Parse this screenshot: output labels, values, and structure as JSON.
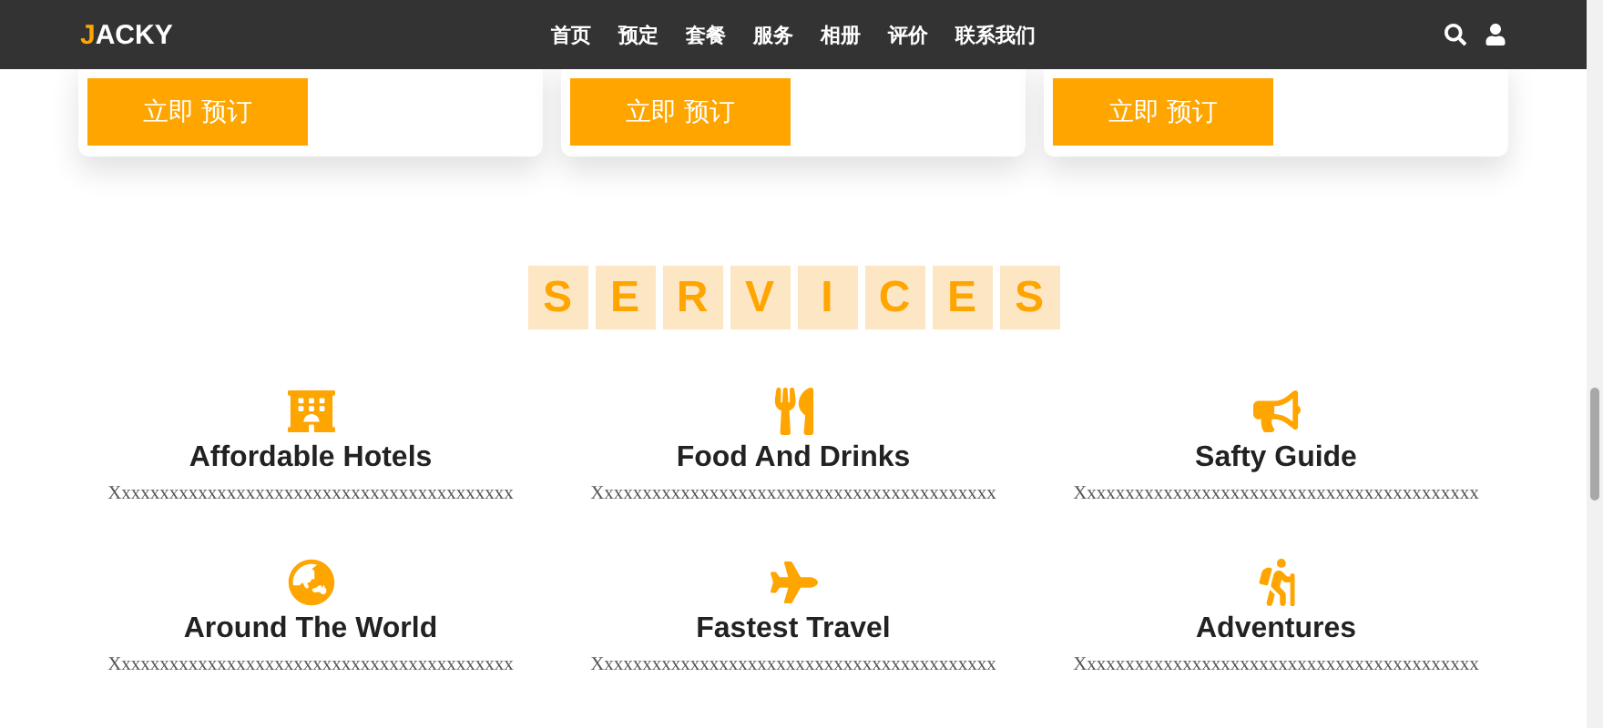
{
  "header": {
    "brand": {
      "accent": "J",
      "rest": "ACKY"
    },
    "nav": [
      "首页",
      "预定",
      "套餐",
      "服务",
      "相册",
      "评价",
      "联系我们"
    ]
  },
  "cards": [
    {
      "button": "立即 预订"
    },
    {
      "button": "立即 预订"
    },
    {
      "button": "立即 预订"
    }
  ],
  "services": {
    "title_letters": [
      "S",
      "E",
      "R",
      "V",
      "I",
      "C",
      "E",
      "S"
    ],
    "items": [
      {
        "kind": "hotel",
        "title": "Affordable Hotels",
        "text": "Xxxxxxxxxxxxxxxxxxxxxxxxxxxxxxxxxxxxxxxxxx"
      },
      {
        "kind": "food",
        "title": "Food And Drinks",
        "text": "Xxxxxxxxxxxxxxxxxxxxxxxxxxxxxxxxxxxxxxxxxx"
      },
      {
        "kind": "safety",
        "title": "Safty Guide",
        "text": "Xxxxxxxxxxxxxxxxxxxxxxxxxxxxxxxxxxxxxxxxxx"
      },
      {
        "kind": "world",
        "title": "Around The World",
        "text": "Xxxxxxxxxxxxxxxxxxxxxxxxxxxxxxxxxxxxxxxxxx"
      },
      {
        "kind": "travel",
        "title": "Fastest Travel",
        "text": "Xxxxxxxxxxxxxxxxxxxxxxxxxxxxxxxxxxxxxxxxxx"
      },
      {
        "kind": "adventure",
        "title": "Adventures",
        "text": "Xxxxxxxxxxxxxxxxxxxxxxxxxxxxxxxxxxxxxxxxxx"
      }
    ]
  }
}
